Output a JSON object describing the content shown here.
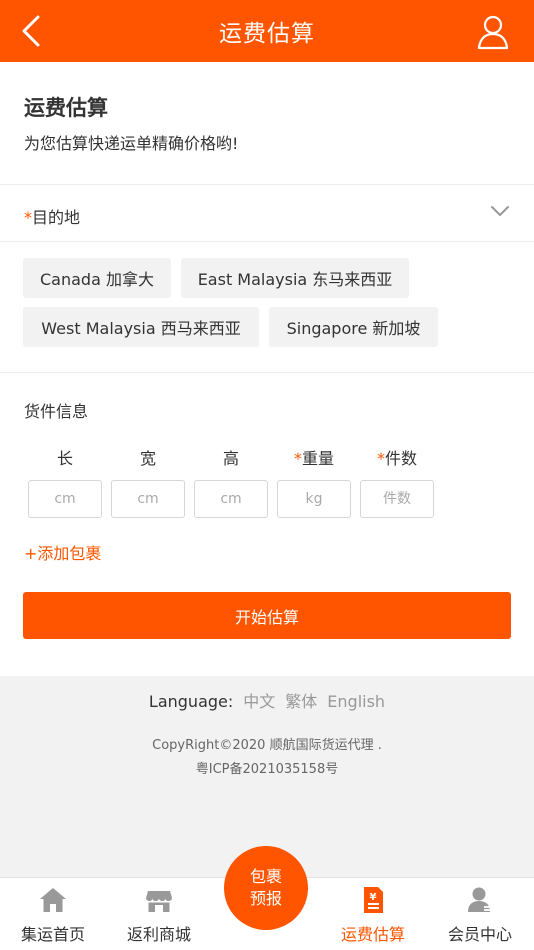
{
  "header": {
    "title": "运费估算"
  },
  "intro": {
    "title": "运费估算",
    "subtitle": "为您估算快递运单精确价格哟!"
  },
  "destination": {
    "required_mark": "*",
    "label": "目的地",
    "options": [
      "Canada 加拿大",
      "East Malaysia 东马来西亚",
      "West Malaysia 西马来西亚",
      "Singapore 新加坡"
    ]
  },
  "cargo": {
    "title": "货件信息",
    "columns": [
      {
        "required": "",
        "label": "长",
        "placeholder": "cm"
      },
      {
        "required": "",
        "label": "宽",
        "placeholder": "cm"
      },
      {
        "required": "",
        "label": "高",
        "placeholder": "cm"
      },
      {
        "required": "*",
        "label": "重量",
        "placeholder": "kg"
      },
      {
        "required": "*",
        "label": "件数",
        "placeholder": "件数"
      }
    ],
    "add_package": "+添加包裹",
    "start_button": "开始估算"
  },
  "footer": {
    "language_label": "Language:",
    "languages": [
      "中文",
      "繁体",
      "English"
    ],
    "copyright": "CopyRight©2020 顺航国际货运代理 .",
    "icp": "粤ICP备2021035158号"
  },
  "tabbar": {
    "items": [
      {
        "label": "集运首页",
        "icon": "home-icon"
      },
      {
        "label": "返利商城",
        "icon": "store-icon"
      },
      {
        "label": "运费估算",
        "icon": "freight-calc-icon",
        "active": true
      },
      {
        "label": "会员中心",
        "icon": "member-icon"
      }
    ],
    "center_line1": "包裹",
    "center_line2": "预报"
  },
  "colors": {
    "accent": "#ff5500",
    "background": "#f2f2f2"
  }
}
